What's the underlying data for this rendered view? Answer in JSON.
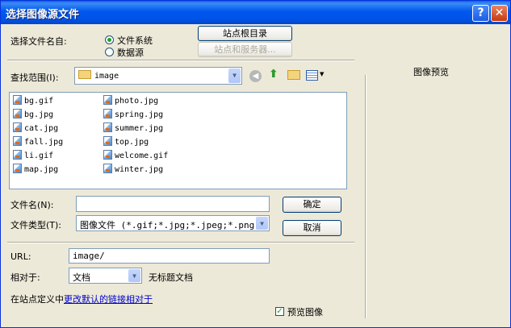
{
  "window": {
    "title": "选择图像源文件"
  },
  "select_from": {
    "label": "选择文件名自:",
    "options": [
      "文件系统",
      "数据源"
    ],
    "selected": "文件系统"
  },
  "buttons": {
    "site_root": "站点根目录",
    "site_servers": "站点和服务器...",
    "ok": "确定",
    "cancel": "取消"
  },
  "look_in": {
    "label": "查找范围(I):",
    "value": "image"
  },
  "files": {
    "col1": [
      "bg.gif",
      "bg.jpg",
      "cat.jpg",
      "fall.jpg",
      "li.gif",
      "map.jpg"
    ],
    "col2": [
      "photo.jpg",
      "spring.jpg",
      "summer.jpg",
      "top.jpg",
      "welcome.gif",
      "winter.jpg"
    ]
  },
  "filename": {
    "label": "文件名(N):",
    "value": ""
  },
  "filetype": {
    "label": "文件类型(T):",
    "value": "图像文件 (*.gif;*.jpg;*.jpeg;*.png;*"
  },
  "url": {
    "label": "URL:",
    "value": "image/"
  },
  "relative_to": {
    "label": "相对于:",
    "value": "文档",
    "doc_name": "无标题文档"
  },
  "site_def": {
    "text": "在站点定义中",
    "link": "更改默认的链接相对于"
  },
  "preview": {
    "title": "图像预览",
    "checkbox_label": "预览图像",
    "checked": true
  }
}
